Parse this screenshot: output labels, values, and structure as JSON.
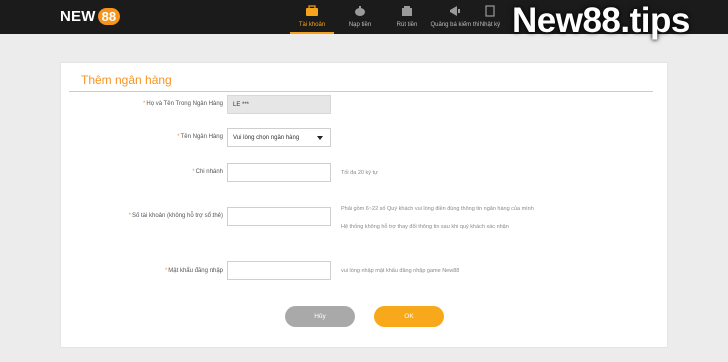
{
  "header": {
    "logo_text": "NEW",
    "logo_num": "88",
    "nav": [
      {
        "label": "Tài khoản",
        "icon": "account-icon",
        "active": true
      },
      {
        "label": "Nạp tiền",
        "icon": "piggy-bank-icon",
        "active": false
      },
      {
        "label": "Rút tiền",
        "icon": "wallet-icon",
        "active": false
      },
      {
        "label": "Quảng bá kiếm thì",
        "icon": "megaphone-icon",
        "active": false
      },
      {
        "label": "Nhật ký",
        "icon": "log-icon",
        "active": false
      }
    ],
    "watermark": "New88.tips"
  },
  "form": {
    "title": "Thêm ngân hàng",
    "fields": [
      {
        "label": "Họ và Tên Trong Ngân Hàng",
        "value": "LE ***",
        "hint": ""
      },
      {
        "label": "Tên Ngân Hàng",
        "value": "Vui lòng chọn ngân hàng",
        "hint": ""
      },
      {
        "label": "Chi nhánh",
        "value": "",
        "hint": "Tối đa 20 ký tự"
      },
      {
        "label": "Số tài khoản (không hỗ trợ sổ thẻ)",
        "value": "",
        "hint": "Phải gồm 6~22 số Quý khách vui lòng điền đúng thông tin ngân hàng của mình",
        "hint2": "Hệ thống không hỗ trợ thay đổi thông tin sau khi quý khách xác nhận"
      },
      {
        "label": "Mật khẩu đăng nhập",
        "value": "",
        "hint": "vui lòng nhập mật khẩu đăng nhập game New88"
      }
    ],
    "cancel_label": "Hủy",
    "ok_label": "OK"
  },
  "colors": {
    "accent": "#f7941d",
    "ok_button": "#f7a91b",
    "cancel_button": "#a9a9a9",
    "topbar": "#1b1b1b"
  }
}
